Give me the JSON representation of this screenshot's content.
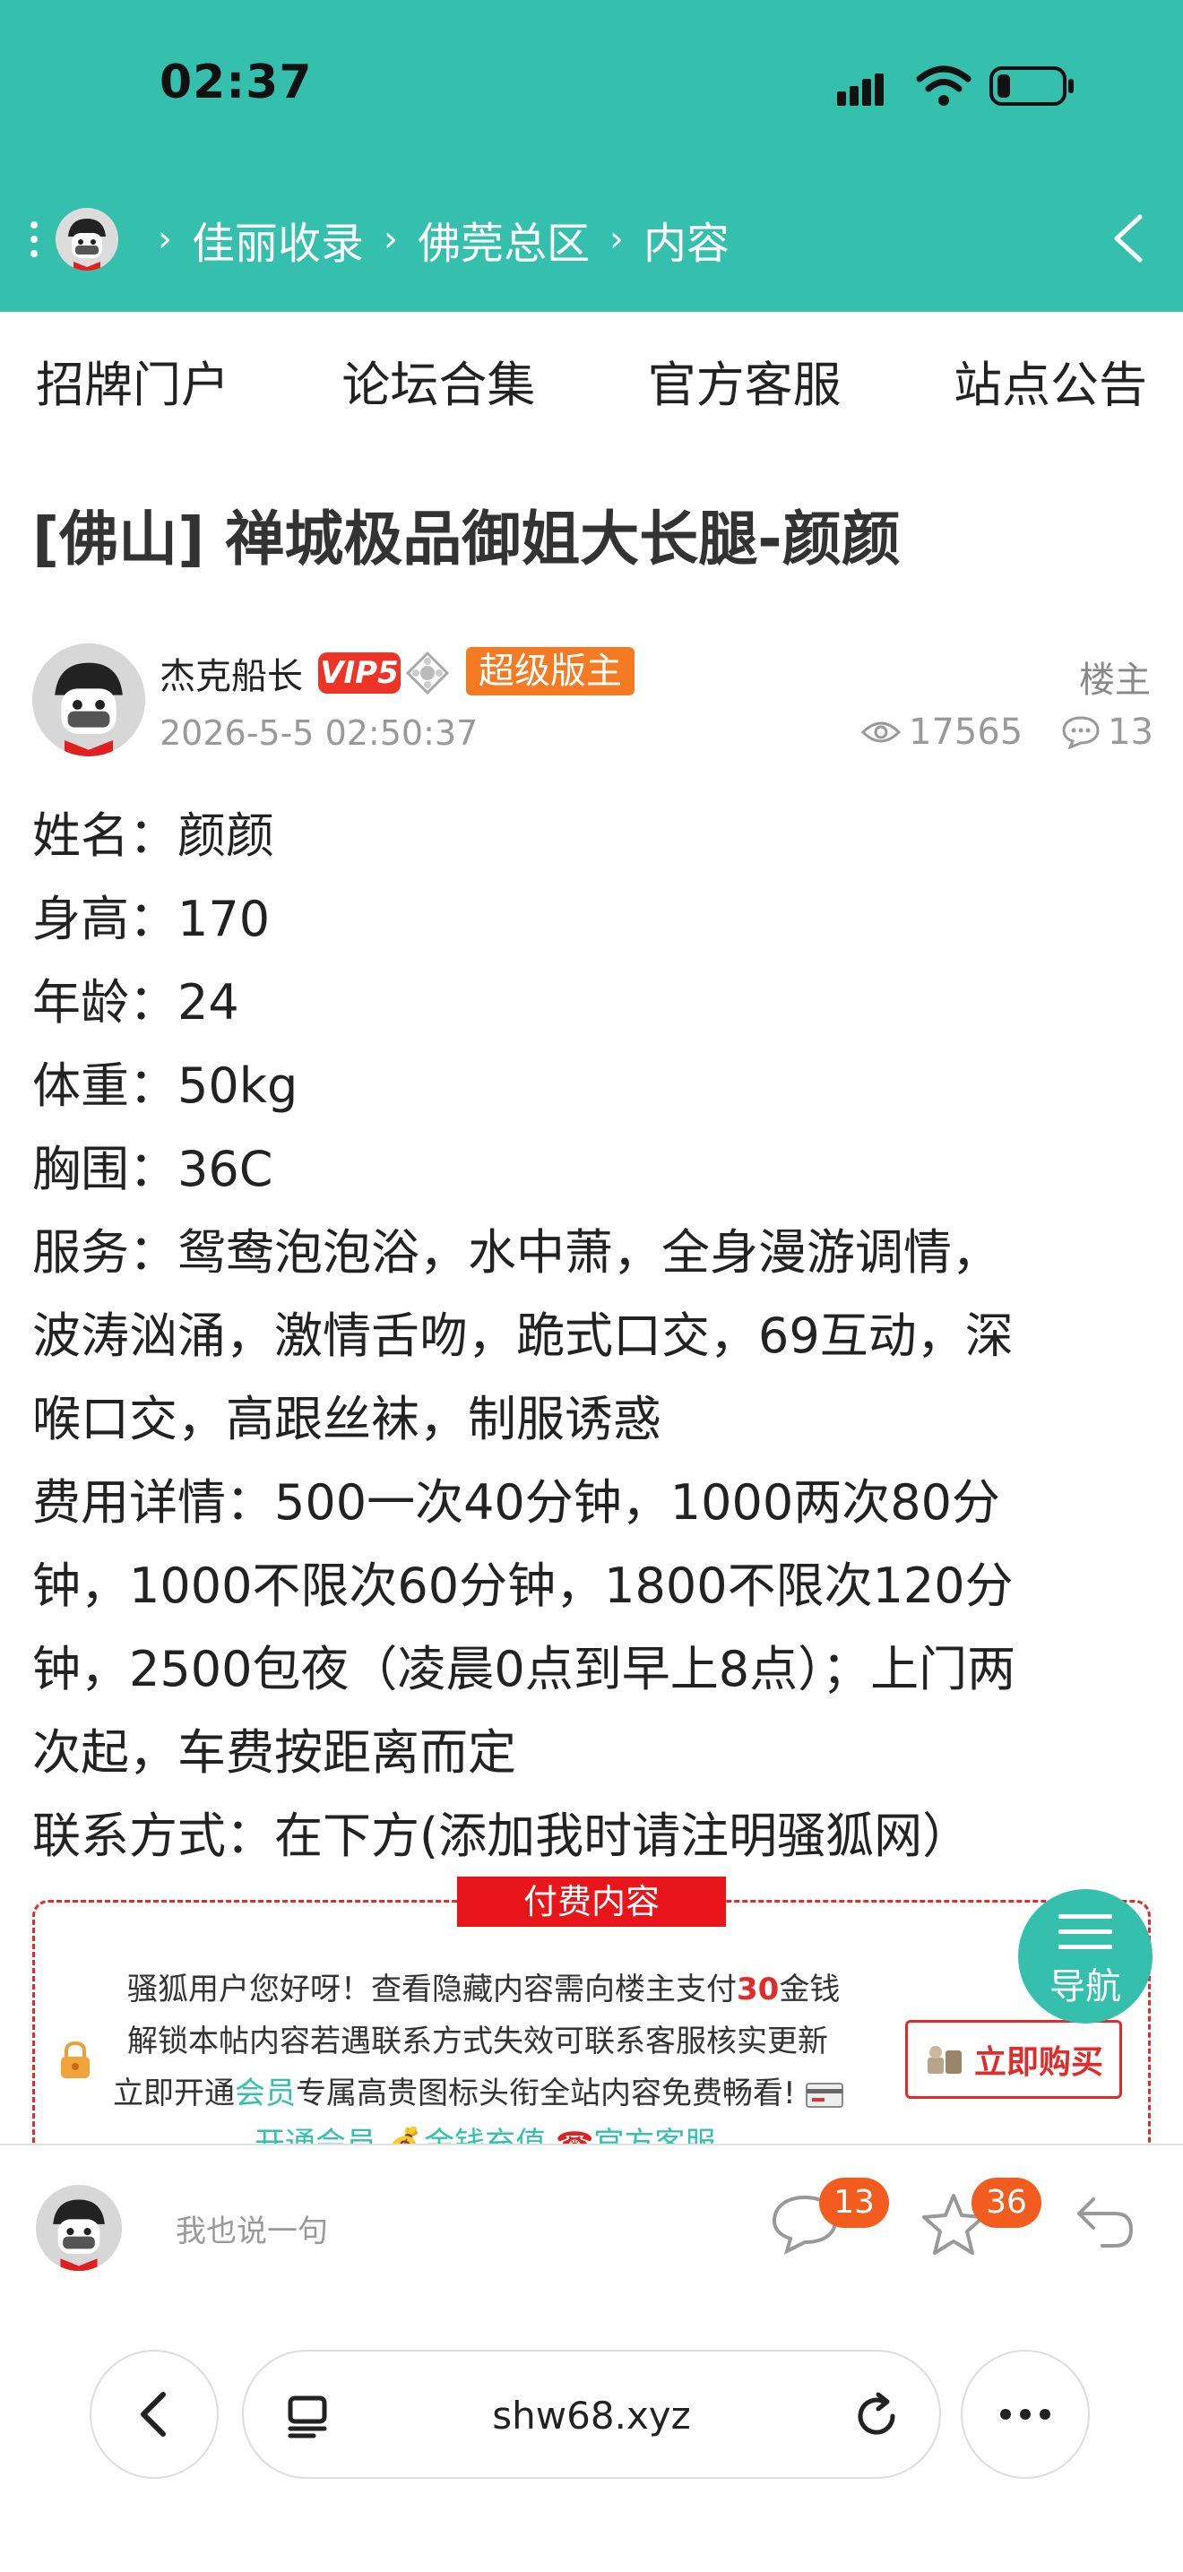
{
  "status": {
    "time": "02:37"
  },
  "breadcrumb": {
    "items": [
      "佳丽收录",
      "佛莞总区",
      "内容"
    ],
    "separator": "›"
  },
  "nav": {
    "items": [
      "招牌门户",
      "论坛合集",
      "官方客服",
      "站点公告"
    ]
  },
  "post": {
    "title": "[佛山] 禅城极品御姐大长腿-颜颜",
    "author": "杰克船长",
    "vip_label": "VIP5",
    "role": "超级版主",
    "floor_label": "楼主",
    "datetime": "2026-5-5 02:50:37",
    "views": "17565",
    "comments": "13",
    "lines": [
      "姓名：颜颜",
      "身高：170",
      "年龄：24",
      "体重：50kg",
      "胸围：36C",
      "服务：鸳鸯泡泡浴，水中萧，全身漫游调情，",
      "波涛汹涌，激情舌吻，跪式口交，69互动，深",
      "喉口交，高跟丝袜，制服诱惑",
      "费用详情：500一次40分钟，1000两次80分",
      "钟，1000不限次60分钟，1800不限次120分",
      "钟，2500包夜（凌晨0点到早上8点）；上门两",
      "次起，车费按距离而定",
      "联系方式：在下方(添加我时请注明骚狐网）"
    ]
  },
  "paid": {
    "title": "付费内容",
    "line1_a": "骚狐用户您好呀！查看隐藏内容需向楼主支付",
    "line1_amount": "30",
    "line1_b": "金钱",
    "line2": "解锁本帖内容若遇联系方式失效可联系客服核实更新",
    "line3_a": "立即开通",
    "line3_link": "会员",
    "line3_b": "专属高贵图标头衔全站内容免费畅看!",
    "links": [
      "开通会员",
      "金钱充值",
      "官方客服"
    ],
    "buy_label": "立即购买",
    "nav_label": "导航"
  },
  "reply": {
    "placeholder": "我也说一句",
    "comment_count": "13",
    "favorite_count": "36"
  },
  "browser": {
    "url": "shw68.xyz"
  },
  "colors": {
    "brand": "#35c0ad",
    "accent_red": "#e12b2b",
    "badge_orange": "#f35c1f"
  }
}
